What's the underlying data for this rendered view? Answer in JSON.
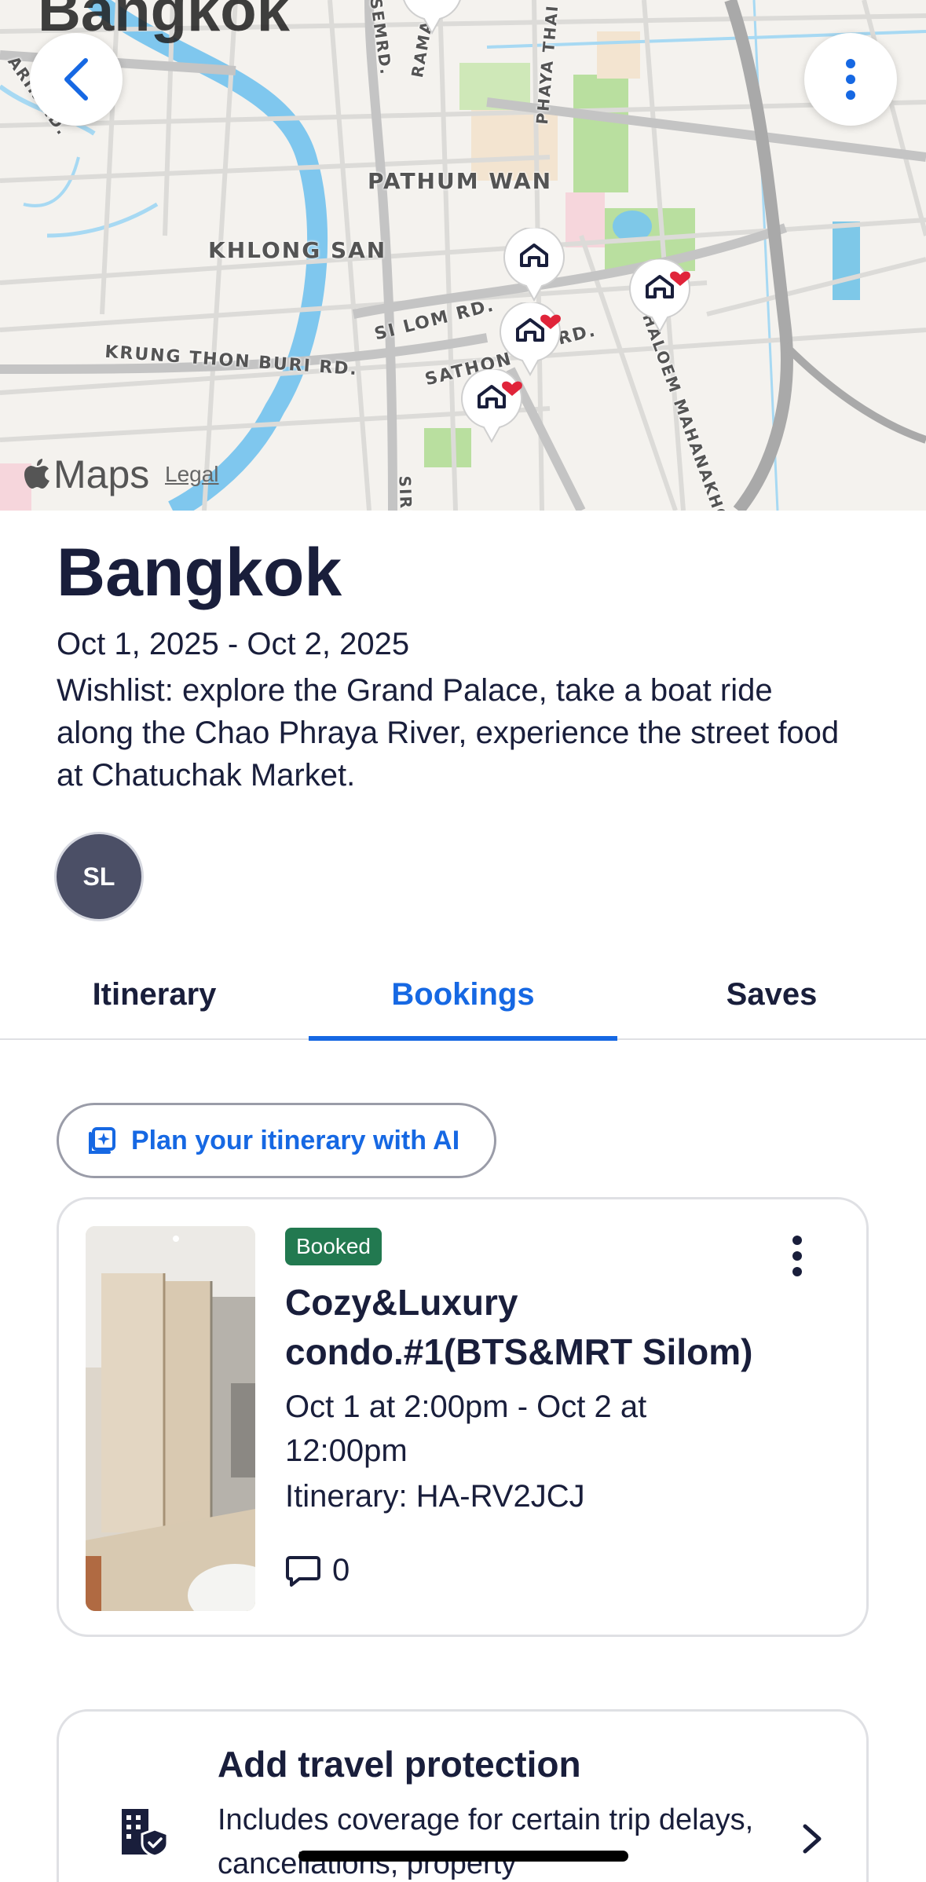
{
  "map": {
    "city_overlay_title": "Bangkok",
    "labels": [
      {
        "text": "PATHUM WAN"
      },
      {
        "text": "KHLONG SAN"
      },
      {
        "text": "KRUNG THON BURI RD."
      },
      {
        "text": "SI LOM RD."
      },
      {
        "text": "SATHON"
      },
      {
        "text": "RD."
      },
      {
        "text": "PHAYA THAI"
      },
      {
        "text": "RAMA"
      },
      {
        "text": "CHALOEM MAHANAKHON EXPRESSWAY"
      },
      {
        "text": "ISEMRD."
      },
      {
        "text": "ARIN RD."
      },
      {
        "text": "SIRI"
      }
    ],
    "brand": "Maps",
    "legal": "Legal",
    "back_icon": "chevron-left-icon",
    "more_icon": "more-vertical-icon",
    "pin_icon": "home-pin-icon"
  },
  "trip": {
    "title": "Bangkok",
    "dates": "Oct 1, 2025 - Oct 2, 2025",
    "description": "Wishlist: explore the Grand Palace, take a boat ride along the Chao Phraya River, experience the street food at Chatuchak Market.",
    "avatar_initials": "SL"
  },
  "tabs": [
    {
      "label": "Itinerary",
      "active": false
    },
    {
      "label": "Bookings",
      "active": true
    },
    {
      "label": "Saves",
      "active": false
    }
  ],
  "ai_button": {
    "label": "Plan your itinerary with AI",
    "icon": "ai-sparkle-icon"
  },
  "booking": {
    "status": "Booked",
    "name": "Cozy&Luxury condo.#1(BTS&MRT Silom)",
    "stay": "Oct 1 at 2:00pm - Oct 2 at 12:00pm",
    "itinerary": "Itinerary: HA-RV2JCJ",
    "comment_count": "0"
  },
  "protection": {
    "title": "Add travel protection",
    "text": "Includes coverage for certain trip delays, cancellations, property",
    "icon": "building-shield-icon"
  },
  "colors": {
    "accent": "#1668e3",
    "text": "#191e3b",
    "booked_badge": "#227950",
    "pin_heart": "#e0243a"
  }
}
